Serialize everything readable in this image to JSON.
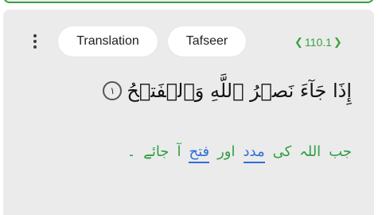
{
  "toolbar": {
    "translation_label": "Translation",
    "tafseer_label": "Tafseer"
  },
  "verse": {
    "reference": "110.1",
    "arabic_text": "إِذَا جَآءَ نَصۡرُ ٱللَّهِ وَٱلۡفَتۡحُ",
    "ayah_number": "١"
  },
  "translation": {
    "words": [
      {
        "text": "جب",
        "highlight": false
      },
      {
        "text": "اللہ",
        "highlight": false
      },
      {
        "text": "کی",
        "highlight": false
      },
      {
        "text": "مدد",
        "highlight": true
      },
      {
        "text": "اور",
        "highlight": false
      },
      {
        "text": "فتح",
        "highlight": true
      },
      {
        "text": "آ",
        "highlight": false
      },
      {
        "text": "جائے",
        "highlight": false
      },
      {
        "text": "۔",
        "highlight": false
      }
    ]
  },
  "colors": {
    "accent_green": "#3aa141",
    "highlight_blue": "#2f6fd6",
    "card_bg": "#ebebeb"
  },
  "icons": {
    "menu": "more-vertical-icon",
    "ornament_left": "ornament-left-icon",
    "ornament_right": "ornament-right-icon"
  }
}
